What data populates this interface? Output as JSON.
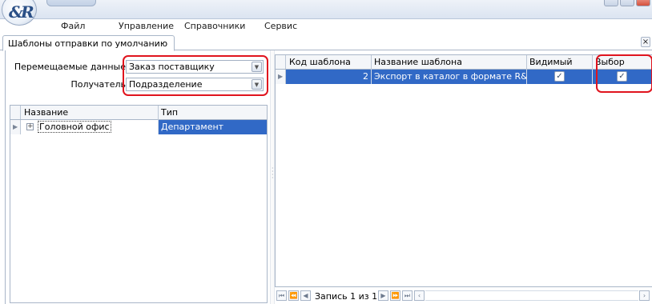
{
  "menu": {
    "items": [
      {
        "label": "Файл"
      },
      {
        "label": "Управление"
      },
      {
        "label": "Справочники"
      },
      {
        "label": "Сервис"
      }
    ]
  },
  "tab": {
    "title": "Шаблоны отправки по умолчанию",
    "close_glyph": "×"
  },
  "filters": {
    "data_label": "Перемещаемые данные",
    "data_value": "Заказ поставщику",
    "recipient_label": "Получатель",
    "recipient_value": "Подразделение"
  },
  "tree": {
    "columns": [
      "Название",
      "Тип"
    ],
    "rows": [
      {
        "name": "Головной офис",
        "type": "Департамент"
      }
    ]
  },
  "templates": {
    "columns": [
      "Код шаблона",
      "Название шаблона",
      "Видимый",
      "Выбор"
    ],
    "rows": [
      {
        "code": "2",
        "name": "Экспорт в каталог в формате  R&...",
        "visible": true,
        "selected": true
      }
    ]
  },
  "pager": {
    "text": "Запись 1 из 1"
  },
  "icons": {
    "app_logo": "app-logo-icon",
    "checkbox_checked": "✓",
    "expander": "plus-icon",
    "row_pointer": "triangle-right-icon"
  },
  "colors": {
    "selection": "#3169c6",
    "highlight": "#e0141e"
  }
}
